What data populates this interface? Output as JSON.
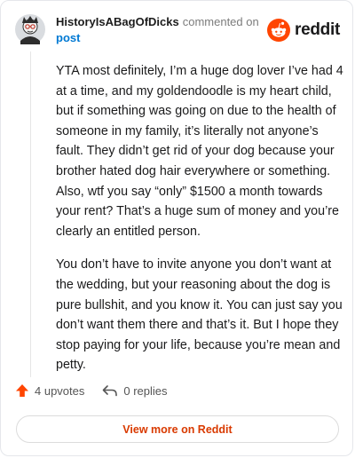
{
  "header": {
    "username": "HistoryIsABagOfDicks",
    "action_text": "commented on",
    "post_link": "post"
  },
  "logo": {
    "word": "reddit",
    "icon": "reddit-snoo-icon"
  },
  "comment": {
    "paragraphs": [
      "YTA most definitely, I’m a huge dog lover I’ve had 4 at a time, and my goldendoodle is my heart child, but if something was going on due to the health of someone in my family, it’s literally not anyone’s fault. They didn’t get rid of your dog because your brother hated dog hair everywhere or something. Also, wtf you say “only” $1500 a month towards your rent? That’s a huge sum of money and you’re clearly an entitled person.",
      "You don’t have to invite anyone you don’t want at the wedding, but your reasoning about the dog is pure bullshit, and you know it. You can just say you don’t want them there and that’s it. But I hope they stop paying for your life, because you’re mean and petty."
    ]
  },
  "actions": {
    "upvotes": "4 upvotes",
    "replies": "0 replies"
  },
  "footer": {
    "view_more": "View more on Reddit"
  },
  "colors": {
    "accent": "#ff4500",
    "link": "#0079d3",
    "button_text": "#d93a00"
  }
}
